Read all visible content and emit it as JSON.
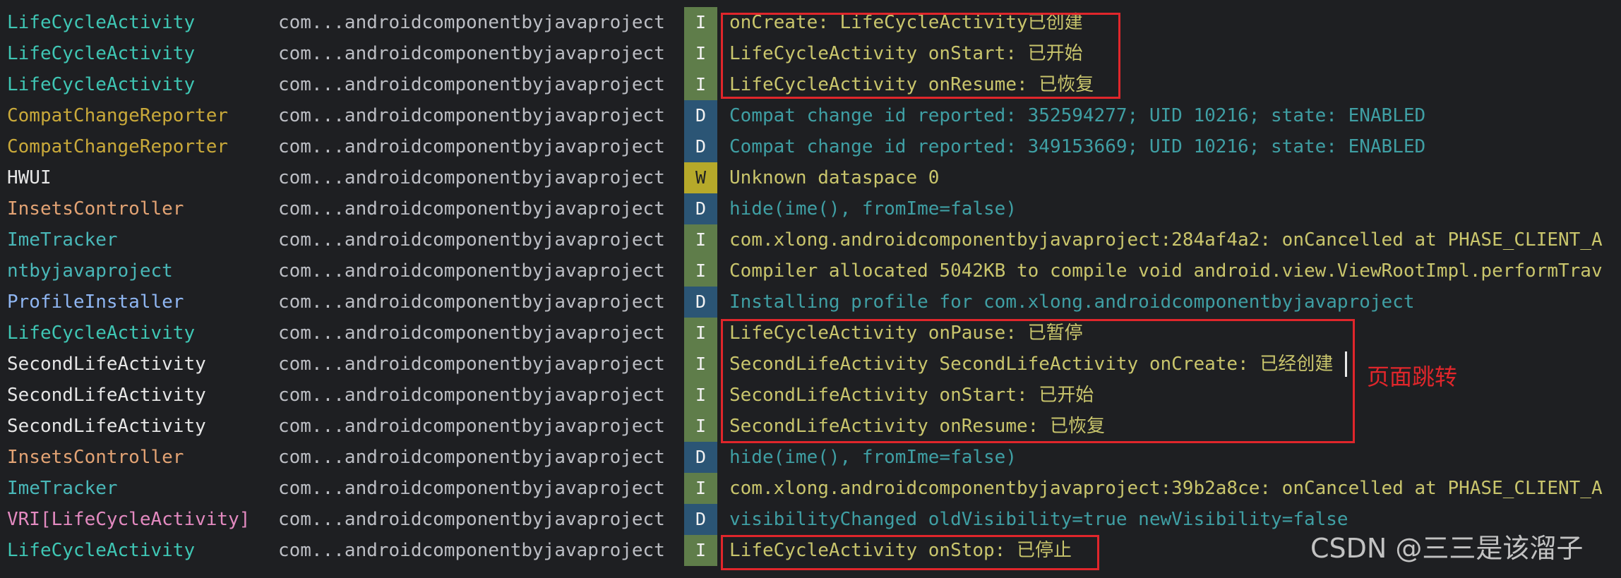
{
  "colors": {
    "tag_green_cyan": "#3fc6b4",
    "tag_yellow": "#c9a93a",
    "tag_white": "#e6e6e6",
    "tag_orange": "#e3a374",
    "tag_teal": "#49b7b8",
    "tag_blue": "#8fb6f2",
    "tag_pink": "#e38ac0",
    "annotation_red": "#e0262b"
  },
  "log": {
    "rows": [
      {
        "tag": "LifeCycleActivity",
        "tag_color": "#3fc6b4",
        "package": "com...androidcomponentbyjavaproject",
        "level": "I",
        "message": "onCreate: LifeCycleActivity已创建"
      },
      {
        "tag": "LifeCycleActivity",
        "tag_color": "#3fc6b4",
        "package": "com...androidcomponentbyjavaproject",
        "level": "I",
        "message": "LifeCycleActivity onStart: 已开始"
      },
      {
        "tag": "LifeCycleActivity",
        "tag_color": "#3fc6b4",
        "package": "com...androidcomponentbyjavaproject",
        "level": "I",
        "message": "LifeCycleActivity onResume: 已恢复"
      },
      {
        "tag": "CompatChangeReporter",
        "tag_color": "#c9a93a",
        "package": "com...androidcomponentbyjavaproject",
        "level": "D",
        "message": "Compat change id reported: 352594277; UID 10216; state: ENABLED"
      },
      {
        "tag": "CompatChangeReporter",
        "tag_color": "#c9a93a",
        "package": "com...androidcomponentbyjavaproject",
        "level": "D",
        "message": "Compat change id reported: 349153669; UID 10216; state: ENABLED"
      },
      {
        "tag": "HWUI",
        "tag_color": "#e6e6e6",
        "package": "com...androidcomponentbyjavaproject",
        "level": "W",
        "message": "Unknown dataspace 0"
      },
      {
        "tag": "InsetsController",
        "tag_color": "#e3a374",
        "package": "com...androidcomponentbyjavaproject",
        "level": "D",
        "message": "hide(ime(), fromIme=false)"
      },
      {
        "tag": "ImeTracker",
        "tag_color": "#49b7b8",
        "package": "com...androidcomponentbyjavaproject",
        "level": "I",
        "message": "com.xlong.androidcomponentbyjavaproject:284af4a2: onCancelled at PHASE_CLIENT_A"
      },
      {
        "tag": "ntbyjavaproject",
        "tag_color": "#49b7b8",
        "package": "com...androidcomponentbyjavaproject",
        "level": "I",
        "message": "Compiler allocated 5042KB to compile void android.view.ViewRootImpl.performTrav"
      },
      {
        "tag": "ProfileInstaller",
        "tag_color": "#8fb6f2",
        "package": "com...androidcomponentbyjavaproject",
        "level": "D",
        "message": "Installing profile for com.xlong.androidcomponentbyjavaproject"
      },
      {
        "tag": "LifeCycleActivity",
        "tag_color": "#3fc6b4",
        "package": "com...androidcomponentbyjavaproject",
        "level": "I",
        "message": "LifeCycleActivity onPause: 已暂停"
      },
      {
        "tag": "SecondLifeActivity",
        "tag_color": "#e6e6e6",
        "package": "com...androidcomponentbyjavaproject",
        "level": "I",
        "message": "SecondLifeActivity SecondLifeActivity onCreate: 已经创建"
      },
      {
        "tag": "SecondLifeActivity",
        "tag_color": "#e6e6e6",
        "package": "com...androidcomponentbyjavaproject",
        "level": "I",
        "message": "SecondLifeActivity onStart: 已开始"
      },
      {
        "tag": "SecondLifeActivity",
        "tag_color": "#e6e6e6",
        "package": "com...androidcomponentbyjavaproject",
        "level": "I",
        "message": "SecondLifeActivity onResume: 已恢复"
      },
      {
        "tag": "InsetsController",
        "tag_color": "#e3a374",
        "package": "com...androidcomponentbyjavaproject",
        "level": "D",
        "message": "hide(ime(), fromIme=false)"
      },
      {
        "tag": "ImeTracker",
        "tag_color": "#49b7b8",
        "package": "com...androidcomponentbyjavaproject",
        "level": "I",
        "message": "com.xlong.androidcomponentbyjavaproject:39b2a8ce: onCancelled at PHASE_CLIENT_A"
      },
      {
        "tag": "VRI[LifeCycleActivity]",
        "tag_color": "#e38ac0",
        "package": "com...androidcomponentbyjavaproject",
        "level": "D",
        "message": "visibilityChanged oldVisibility=true newVisibility=false"
      },
      {
        "tag": "LifeCycleActivity",
        "tag_color": "#3fc6b4",
        "package": "com...androidcomponentbyjavaproject",
        "level": "I",
        "message": "LifeCycleActivity onStop: 已停止"
      }
    ]
  },
  "annotation": {
    "note": "页面跳转"
  },
  "watermark": "CSDN @三三是该溜子"
}
